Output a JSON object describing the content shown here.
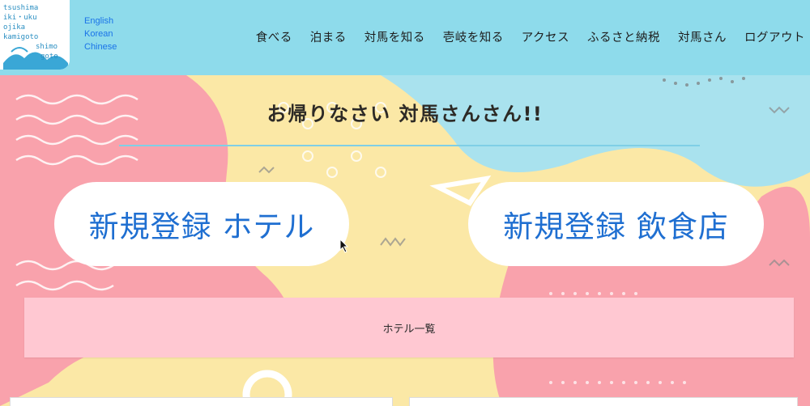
{
  "logo": {
    "text_lines": [
      "tsushima",
      "iki・uku",
      "ojika",
      "kamigoto",
      "shimo",
      "goto"
    ]
  },
  "languages": [
    "English",
    "Korean",
    "Chinese"
  ],
  "nav": [
    "食べる",
    "泊まる",
    "対馬を知る",
    "壱岐を知る",
    "アクセス",
    "ふるさと納税",
    "対馬さん",
    "ログアウト"
  ],
  "hero": {
    "welcome": "お帰りなさい 対馬さんさん!!",
    "register_hotel": "新規登録 ホテル",
    "register_restaurant": "新規登録 飲食店",
    "hotel_list": "ホテル一覧"
  },
  "colors": {
    "header_bg": "#8edbeb",
    "link_blue": "#1f6fd1",
    "pink_bar": "#ffc8d2",
    "bg_yellow": "#fbe8a6",
    "bg_pink": "#f9a2ac",
    "bg_blue": "#a9e2ee"
  }
}
